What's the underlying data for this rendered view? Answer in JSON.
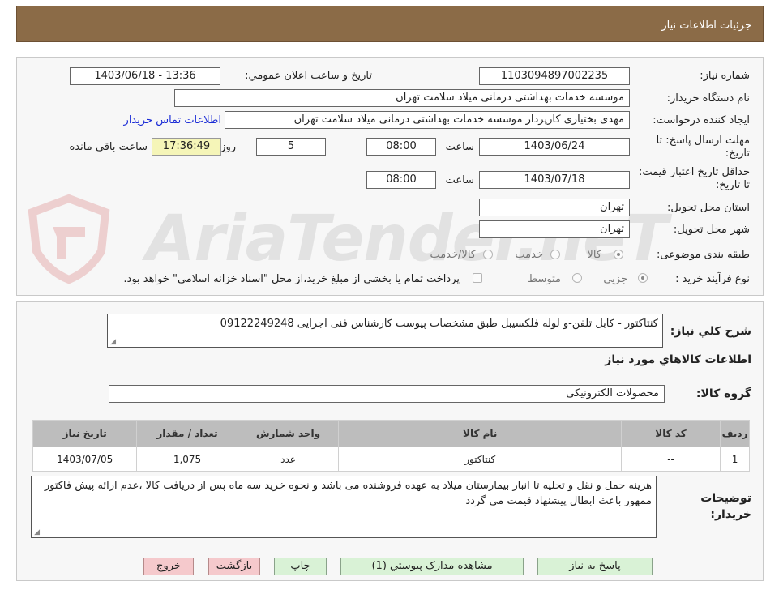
{
  "header": {
    "title": "جزئیات اطلاعات نیاز"
  },
  "watermark": {
    "text": "AriaTender.neT"
  },
  "form": {
    "need_number_label": "شماره نیاز:",
    "need_number": "1103094897002235",
    "announce_label": "تاریخ و ساعت اعلان عمومي:",
    "announce_value": "1403/06/18 - 13:36",
    "buyer_org_label": "نام دستگاه خریدار:",
    "buyer_org": "موسسه خدمات بهداشتی درمانی میلاد سلامت تهران",
    "requester_label": "ایجاد کننده درخواست:",
    "requester": "مهدی بختیاری کارپرداز موسسه خدمات بهداشتی درمانی میلاد سلامت تهران",
    "contact_link": "اطلاعات تماس خریدار",
    "deadline_label": "مهلت ارسال پاسخ: تا تاریخ:",
    "deadline_date": "1403/06/24",
    "time_label": "ساعت",
    "deadline_time": "08:00",
    "days_value": "5",
    "days_label": "روز و",
    "remaining_time": "17:36:49",
    "remaining_label": "ساعت باقي مانده",
    "validity_label": "حداقل تاریخ اعتبار قیمت: تا تاریخ:",
    "validity_date": "1403/07/18",
    "validity_time": "08:00",
    "province_label": "استان محل تحویل:",
    "province": "تهران",
    "city_label": "شهر محل تحویل:",
    "city": "تهران",
    "category_label": "طبقه بندی موضوعی:",
    "category_options": [
      "کالا",
      "خدمت",
      "کالا/خدمت"
    ],
    "process_label": "نوع فرآیند خرید :",
    "process_options": [
      "جزیي",
      "متوسط"
    ],
    "payment_note": "پرداخت تمام یا بخشی از مبلغ خرید،از محل \"اسناد خزانه اسلامی\" خواهد بود."
  },
  "description": {
    "label": "شرح کلي نیاز:",
    "text": "کنتاکتور - کابل تلفن-و لوله فلکسیبل طبق مشخصات پیوست کارشناس فنی اجرایی 09122249248"
  },
  "goods": {
    "section_title": "اطلاعات کالاهاي مورد نیاز",
    "group_label": "گروه کالا:",
    "group_value": "محصولات الکترونیکی",
    "columns": [
      "ردیف",
      "کد کالا",
      "نام کالا",
      "واحد شمارش",
      "تعداد / مقدار",
      "تاریخ نیاز"
    ],
    "rows": [
      [
        "1",
        "--",
        "کنتاکتور",
        "عدد",
        "1,075",
        "1403/07/05"
      ]
    ]
  },
  "buyer_notes": {
    "label": "توضیحات خریدار:",
    "text": "هزینه حمل و نقل و تخلیه تا انبار بیمارستان میلاد به عهده فروشنده می باشد و نحوه خرید سه ماه پس از دریافت کالا ،عدم ارائه پیش فاکتور ممهور باعث ابطال پیشنهاد قیمت می گردد"
  },
  "buttons": {
    "reply": "پاسخ به نیاز",
    "view_docs": "مشاهده مدارک پیوستي (1)",
    "print": "چاپ",
    "back": "بازگشت",
    "exit": "خروج"
  },
  "colors": {
    "header_bg": "#8b6b47",
    "button_green": "#d9f2d6",
    "button_pink": "#f5c9cc",
    "link": "#1a2bd6"
  }
}
